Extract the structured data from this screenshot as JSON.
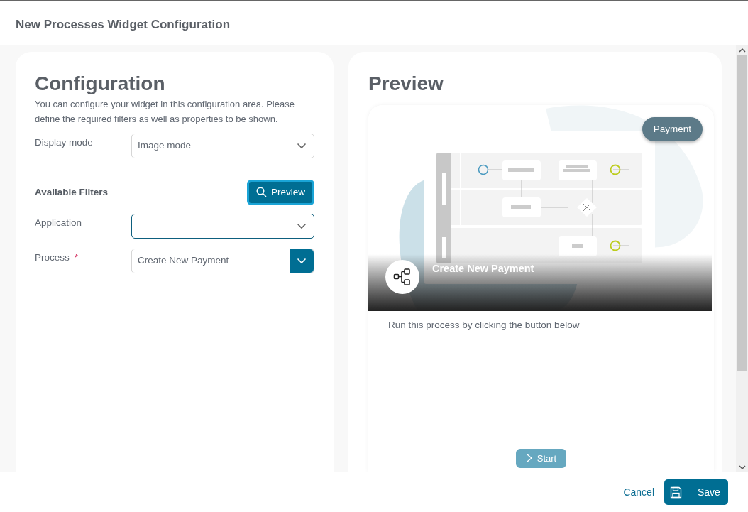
{
  "dialog": {
    "title": "New Processes Widget Configuration"
  },
  "configuration": {
    "heading": "Configuration",
    "description": "You can configure your widget in this configuration area. Please define the required filters as well as properties to be shown.",
    "fields_top": [
      {
        "kind": "select",
        "label": "Display mode",
        "value": "Image mode",
        "focused": false
      }
    ],
    "filters_heading": "Available Filters",
    "preview_button": "Preview",
    "fields": [
      {
        "kind": "select",
        "label": "Application",
        "focused": true
      },
      {
        "kind": "combo",
        "label": "Process",
        "required_mark": "*",
        "value": "Create New Payment",
        "focused": false
      }
    ]
  },
  "preview": {
    "heading": "Preview",
    "card": {
      "tag": "Payment",
      "title": "Create New Payment",
      "description": "Run this process by clicking the button below",
      "button": "Start"
    }
  },
  "footer": {
    "cancel": "Cancel",
    "save": "Save"
  }
}
